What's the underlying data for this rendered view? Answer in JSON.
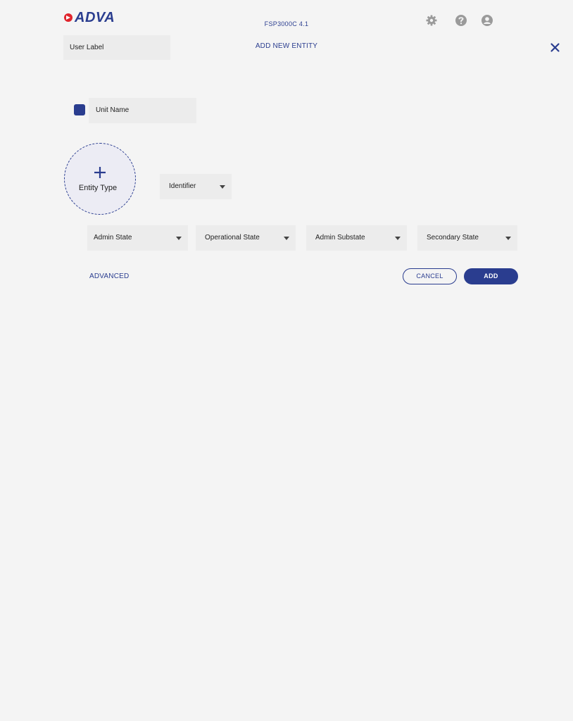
{
  "header": {
    "brand": "ADVA",
    "device": "FSP3000C  4.1",
    "icons": [
      "gear-icon",
      "help-icon",
      "user-account-icon"
    ]
  },
  "dialog": {
    "title": "ADD NEW ENTITY",
    "user_label": "User Label",
    "unit_name": "Unit Name",
    "entity_type": "Entity Type",
    "identifier": "Identifier",
    "admin_state": "Admin State",
    "operational_state": "Operational State",
    "admin_substate": "Admin Substate",
    "secondary_state": "Secondary State",
    "advanced": "ADVANCED",
    "cancel": "CANCEL",
    "add": "ADD"
  },
  "colors": {
    "accent": "#2a3d8f",
    "background": "#f4f4f4",
    "field": "#ececec"
  }
}
